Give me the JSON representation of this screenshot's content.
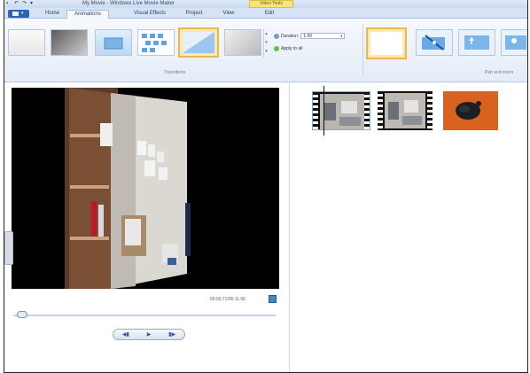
{
  "window": {
    "title": "My Movie - Windows Live Movie Maker",
    "context_tab": "Video Tools"
  },
  "tabs": [
    {
      "label": "Home"
    },
    {
      "label": "Animations"
    },
    {
      "label": "Visual Effects"
    },
    {
      "label": "Project"
    },
    {
      "label": "View"
    },
    {
      "label": "Edit"
    }
  ],
  "ribbon": {
    "transitions_group": "Transitions",
    "panzoom_group": "Pan and zoom",
    "duration_label": "Duration:",
    "duration_value": "1.50",
    "apply_all_label": "Apply to all"
  },
  "preview": {
    "timecode": "00:00.71/00:11.56"
  },
  "transport": {
    "prev_icon": "previous-frame-icon",
    "play_icon": "play-icon",
    "next_icon": "next-frame-icon"
  },
  "colors": {
    "file_button": "#2b63b8",
    "selected_highlight": "#f0b64c",
    "ribbon_bg": "#e4ecf7"
  }
}
